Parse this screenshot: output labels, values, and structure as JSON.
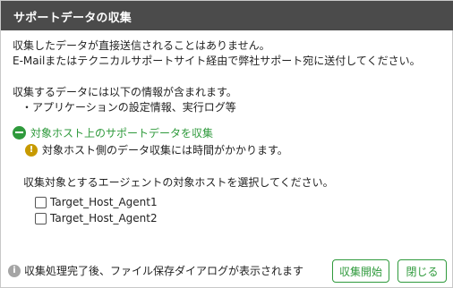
{
  "dialog": {
    "title": "サポートデータの収集",
    "intro_line1": "収集したデータが直接送信されることはありません。",
    "intro_line2": "E-Mailまたはテクニカルサポートサイト経由で弊社サポート宛に送付してください。",
    "contents_line1": "収集するデータには以下の情報が含まれます。",
    "contents_line2": "・アプリケーションの設定情報、実行ログ等",
    "section_title": "対象ホスト上のサポートデータを収集",
    "warning_text": "対象ホスト側のデータ収集には時間がかかります。",
    "select_prompt": "収集対象とするエージェントの対象ホストを選択してください。",
    "agents": [
      {
        "name": "Target_Host_Agent1",
        "checked": false
      },
      {
        "name": "Target_Host_Agent2",
        "checked": false
      }
    ],
    "footer_info": "収集処理完了後、ファイル保存ダイアログが表示されます",
    "collect_button": "収集開始",
    "close_button": "閉じる"
  },
  "colors": {
    "titlebar": "#4b4b4b",
    "accent": "#2f9a3c",
    "warning": "#c79a00"
  },
  "icons": {
    "section": "minus-circle-icon",
    "warning": "exclamation-icon",
    "info": "info-icon"
  }
}
